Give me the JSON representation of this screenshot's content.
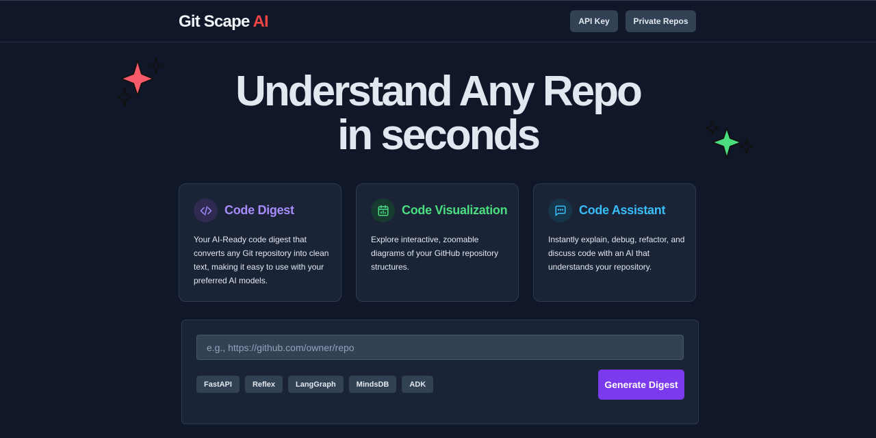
{
  "header": {
    "logo_main": "Git Scape ",
    "logo_accent": "AI",
    "buttons": {
      "api_key": "API Key",
      "private_repos": "Private Repos"
    }
  },
  "hero": {
    "line1": "Understand Any Repo",
    "line2": "in seconds"
  },
  "features": [
    {
      "icon": "code-icon",
      "title": "Code Digest",
      "description": "Your AI-Ready code digest that converts any Git repository into clean text, making it easy to use with your preferred AI models.",
      "accent_color": "#a78bfa"
    },
    {
      "icon": "calendar-chart-icon",
      "title": "Code Visualization",
      "description": "Explore interactive, zoomable diagrams of your GitHub repository structures.",
      "accent_color": "#4ade80"
    },
    {
      "icon": "chat-icon",
      "title": "Code Assistant",
      "description": "Instantly explain, debug, refactor, and discuss code with an AI that understands your repository.",
      "accent_color": "#38bdf8"
    }
  ],
  "repo_form": {
    "placeholder": "e.g., https://github.com/owner/repo",
    "value": "",
    "suggestions": [
      "FastAPI",
      "Reflex",
      "LangGraph",
      "MindsDB",
      "ADK"
    ],
    "submit_label": "Generate Digest"
  },
  "colors": {
    "background": "#0f1729",
    "card": "#1a2436",
    "logo_accent": "#ef4444",
    "primary_button": "#7c3aed",
    "sparkle_red": "#f75a68",
    "sparkle_green": "#4ade80"
  }
}
